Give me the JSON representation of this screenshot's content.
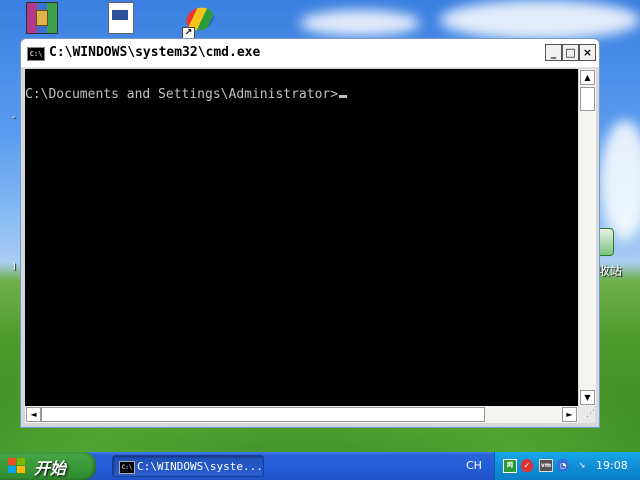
{
  "window": {
    "title": "C:\\WINDOWS\\system32\\cmd.exe",
    "icon_text": "C:\\",
    "minimize_label": "_",
    "maximize_label": "□",
    "close_label": "×",
    "prompt": "C:\\Documents and Settings\\Administrator>"
  },
  "scrollbar": {
    "up_arrow": "▲",
    "down_arrow": "▼",
    "left_arrow": "◄",
    "right_arrow": "►"
  },
  "desktop": {
    "recycle_bin_label": "收站",
    "icons": [
      "winrar-icon",
      "exe-file-icon",
      "shortcut-app-icon",
      "recycle-bin-icon"
    ]
  },
  "taskbar": {
    "start_label": "开始",
    "task_label": "C:\\WINDOWS\\syste...",
    "task_icon_text": "C:\\",
    "language": "CH",
    "clock": "19:08"
  },
  "colors": {
    "console_bg": "#000000",
    "console_fg": "#c0c0c0",
    "taskbar": "#245edb",
    "start_button": "#3a9a3a",
    "tray": "#0f8fd6"
  }
}
